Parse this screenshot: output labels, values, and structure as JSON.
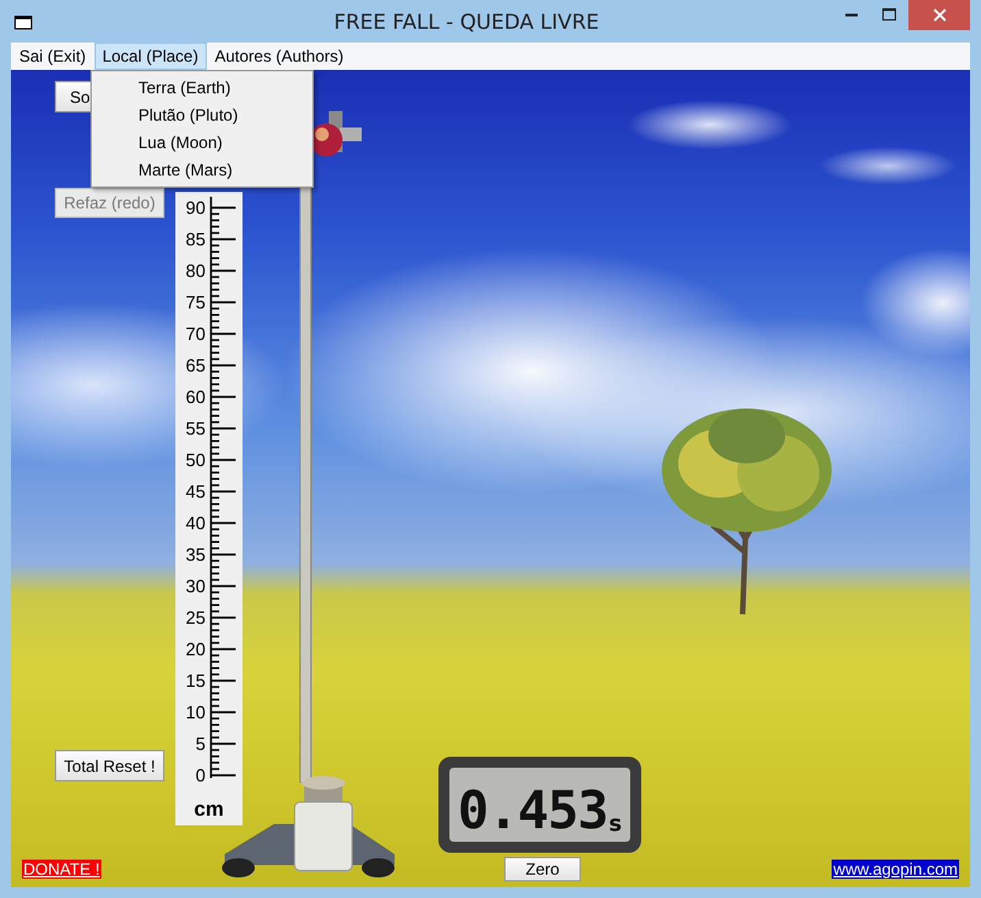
{
  "window": {
    "title": "FREE FALL - QUEDA LIVRE"
  },
  "menu": [
    {
      "label": "Sai (Exit)",
      "selected": false
    },
    {
      "label": "Local (Place)",
      "selected": true
    },
    {
      "label": "Autores (Authors)",
      "selected": false
    }
  ],
  "dropdown": [
    "Terra (Earth)",
    "Plutão (Pluto)",
    "Lua (Moon)",
    "Marte (Mars)"
  ],
  "buttons": [
    {
      "label": "So",
      "disabled": false
    },
    {
      "label": "Refaz (redo)",
      "disabled": true
    },
    {
      "label": "Total Reset !",
      "disabled": false
    }
  ],
  "ruler": {
    "labels": [
      "90",
      "85",
      "80",
      "75",
      "70",
      "65",
      "60",
      "55",
      "50",
      "45",
      "40",
      "35",
      "30",
      "25",
      "20",
      "15",
      "10",
      "5",
      "0"
    ],
    "unit": "cm"
  },
  "timer": {
    "reading": "0.453",
    "unit": "s"
  },
  "zero_button": "Zero",
  "donate_link": "DONATE !",
  "website_link": "www.agopin.com"
}
